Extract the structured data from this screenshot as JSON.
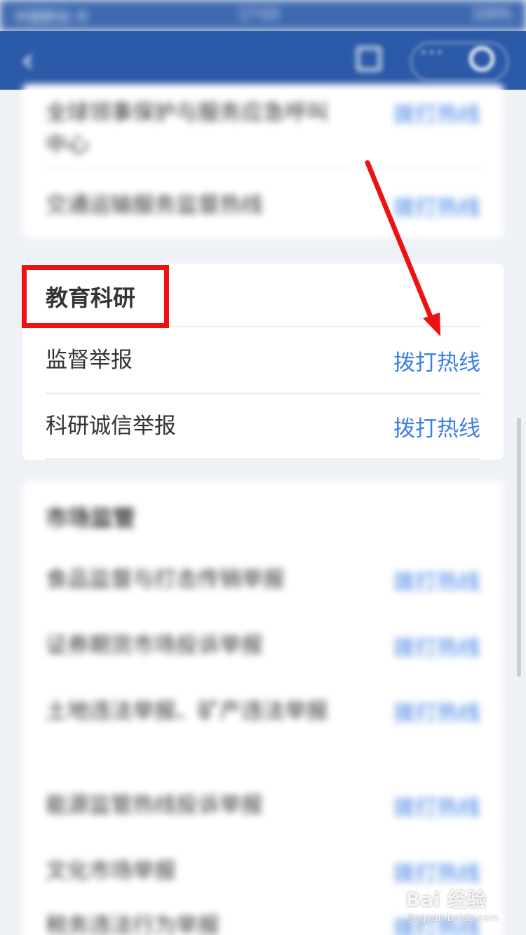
{
  "status_bar": {
    "carrier": "中国移动 令",
    "time": "17:03",
    "battery": "100%"
  },
  "nav": {
    "back_icon": "chevron-left-icon",
    "more": "···"
  },
  "top_card": {
    "items": [
      {
        "label": "全球领事保护与服务应急呼叫中心",
        "action": "拨打热线"
      },
      {
        "label": "交通运输服务监督热线",
        "action": "拨打热线"
      }
    ]
  },
  "edu_section": {
    "title": "教育科研",
    "items": [
      {
        "label": "监督举报",
        "action": "拨打热线"
      },
      {
        "label": "科研诚信举报",
        "action": "拨打热线"
      }
    ]
  },
  "market_section": {
    "title": "市场监管",
    "items": [
      {
        "label": "食品监督与打击传销举报",
        "action": "拨打热线"
      },
      {
        "label": "证券期货市场投诉举报",
        "action": "拨打热线"
      },
      {
        "label": "土地违法举报、矿产违法举报",
        "action": "拨打热线"
      },
      {
        "label": "能源监管热线投诉举报",
        "action": "拨打热线"
      },
      {
        "label": "文化市场举报",
        "action": "拨打热线"
      },
      {
        "label": "税务违法行为举报",
        "action": "拨打热线"
      }
    ]
  },
  "annotation_color": "#ee1111",
  "watermark": {
    "brand": "Bai 经验",
    "url": "jingyan.baidu.com"
  }
}
